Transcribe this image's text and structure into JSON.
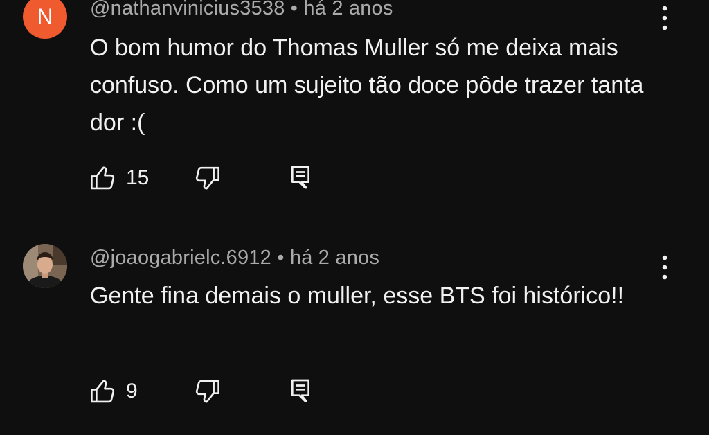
{
  "comments": [
    {
      "avatar_letter": "N",
      "avatar_color": "#ef5a2f",
      "meta": "@nathanvinicius3538 • há 2 anos",
      "text": "O bom humor do Thomas Muller só me deixa mais confuso. Como um sujeito tão doce pôde trazer tanta dor :(",
      "likes": "15"
    },
    {
      "avatar_icon": "user-photo-avatar",
      "meta": "@joaogabrielc.6912 • há 2 anos",
      "text": "Gente fina demais o muller, esse BTS foi histórico!!",
      "likes": "9"
    }
  ],
  "icons": {
    "like": "thumbs-up-icon",
    "dislike": "thumbs-down-icon",
    "reply": "comment-reply-icon",
    "menu": "more-vertical-icon"
  },
  "colors": {
    "background": "#0f0f0f",
    "text": "#f1f1f1",
    "meta": "#aaaaaa"
  }
}
